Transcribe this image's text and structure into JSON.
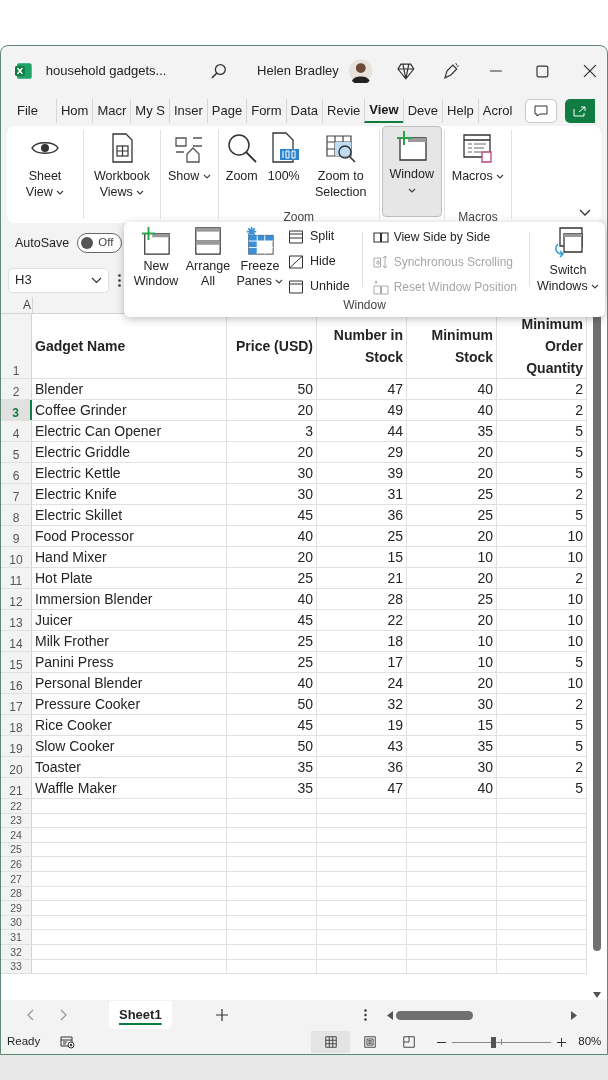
{
  "window": {
    "title": "household gadgets...",
    "user": "Helen Bradley"
  },
  "tabs": [
    {
      "label": "File",
      "selected": false
    },
    {
      "label": "Hom",
      "selected": false
    },
    {
      "label": "Macr",
      "selected": false
    },
    {
      "label": "My S",
      "selected": false
    },
    {
      "label": "Inser",
      "selected": false
    },
    {
      "label": "Page",
      "selected": false
    },
    {
      "label": "Form",
      "selected": false
    },
    {
      "label": "Data",
      "selected": false
    },
    {
      "label": "Revie",
      "selected": false
    },
    {
      "label": "View",
      "selected": true
    },
    {
      "label": "Deve",
      "selected": false
    },
    {
      "label": "Help",
      "selected": false
    },
    {
      "label": "Acrol",
      "selected": false
    }
  ],
  "ribbon": {
    "groups": [
      {
        "buttons": [
          {
            "kind": "eye",
            "label": "Sheet View",
            "dropdown": true,
            "selected": false
          }
        ]
      },
      {
        "buttons": [
          {
            "kind": "workbook",
            "label": "Workbook Views",
            "dropdown": true,
            "selected": false
          }
        ]
      },
      {
        "buttons": [
          {
            "kind": "show",
            "label": "Show",
            "dropdown": true,
            "selected": false
          }
        ]
      },
      {
        "label": "Zoom",
        "buttons": [
          {
            "kind": "zoom",
            "label": "Zoom",
            "dropdown": false,
            "selected": false
          },
          {
            "kind": "hundred",
            "label": "100%",
            "dropdown": false,
            "selected": false
          },
          {
            "kind": "zoomsel",
            "label": "Zoom to Selection",
            "dropdown": false,
            "selected": false
          }
        ]
      },
      {
        "buttons": [
          {
            "kind": "window",
            "label": "Window",
            "dropdown": true,
            "selected": true
          }
        ]
      },
      {
        "label": "Macros",
        "buttons": [
          {
            "kind": "macros",
            "label": "Macros",
            "dropdown": true,
            "selected": false
          }
        ]
      }
    ]
  },
  "autosave": {
    "label": "AutoSave",
    "on": false,
    "state_label": "Off"
  },
  "name_box": {
    "value": "H3"
  },
  "window_panel": {
    "label": "Window",
    "large_buttons": [
      {
        "kind": "newwin",
        "label": "New Window",
        "dropdown": false
      },
      {
        "kind": "arrange",
        "label": "Arrange All",
        "dropdown": false
      },
      {
        "kind": "freeze",
        "label": "Freeze Panes",
        "dropdown": true
      }
    ],
    "small_buttons": [
      {
        "kind": "split",
        "label": "Split"
      },
      {
        "kind": "hide",
        "label": "Hide"
      },
      {
        "kind": "unhide",
        "label": "Unhide"
      }
    ],
    "compare_buttons": [
      {
        "kind": "sidebyside",
        "label": "View Side by Side",
        "disabled": false
      },
      {
        "kind": "sync",
        "label": "Synchronous Scrolling",
        "disabled": true
      },
      {
        "kind": "reset",
        "label": "Reset Window Position",
        "disabled": true
      }
    ],
    "switch_button": {
      "kind": "switch",
      "label": "Switch Windows",
      "dropdown": true
    }
  },
  "sheet": {
    "column_headers": [
      "A"
    ],
    "columns": [
      "Gadget Name",
      "Price (USD)",
      "Number in Stock",
      "Minimum Stock",
      "Minimum Order Quantity"
    ],
    "rows": [
      [
        "Blender",
        "50",
        "47",
        "40",
        "2"
      ],
      [
        "Coffee Grinder",
        "20",
        "49",
        "40",
        "2"
      ],
      [
        "Electric Can Opener",
        "3",
        "44",
        "35",
        "5"
      ],
      [
        "Electric Griddle",
        "20",
        "29",
        "20",
        "5"
      ],
      [
        "Electric Kettle",
        "30",
        "39",
        "20",
        "5"
      ],
      [
        "Electric Knife",
        "30",
        "31",
        "25",
        "2"
      ],
      [
        "Electric Skillet",
        "45",
        "36",
        "25",
        "5"
      ],
      [
        "Food Processor",
        "40",
        "25",
        "20",
        "10"
      ],
      [
        "Hand Mixer",
        "20",
        "15",
        "10",
        "10"
      ],
      [
        "Hot Plate",
        "25",
        "21",
        "20",
        "2"
      ],
      [
        "Immersion Blender",
        "40",
        "28",
        "25",
        "10"
      ],
      [
        "Juicer",
        "45",
        "22",
        "20",
        "10"
      ],
      [
        "Milk Frother",
        "25",
        "18",
        "10",
        "10"
      ],
      [
        "Panini Press",
        "25",
        "17",
        "10",
        "5"
      ],
      [
        "Personal Blender",
        "40",
        "24",
        "20",
        "10"
      ],
      [
        "Pressure Cooker",
        "50",
        "32",
        "30",
        "2"
      ],
      [
        "Rice Cooker",
        "45",
        "19",
        "15",
        "5"
      ],
      [
        "Slow Cooker",
        "50",
        "43",
        "35",
        "5"
      ],
      [
        "Toaster",
        "35",
        "36",
        "30",
        "2"
      ],
      [
        "Waffle Maker",
        "35",
        "47",
        "40",
        "5"
      ]
    ],
    "row_headers": [
      {
        "label": "1",
        "selected": false
      },
      {
        "label": "2",
        "selected": false
      },
      {
        "label": "3",
        "selected": true
      },
      {
        "label": "4",
        "selected": false
      },
      {
        "label": "5",
        "selected": false
      },
      {
        "label": "6",
        "selected": false
      },
      {
        "label": "7",
        "selected": false
      },
      {
        "label": "8",
        "selected": false
      },
      {
        "label": "9",
        "selected": false
      },
      {
        "label": "10",
        "selected": false
      },
      {
        "label": "11",
        "selected": false
      },
      {
        "label": "12",
        "selected": false
      },
      {
        "label": "13",
        "selected": false
      },
      {
        "label": "14",
        "selected": false
      },
      {
        "label": "15",
        "selected": false
      },
      {
        "label": "16",
        "selected": false
      },
      {
        "label": "17",
        "selected": false
      },
      {
        "label": "18",
        "selected": false
      },
      {
        "label": "19",
        "selected": false
      },
      {
        "label": "20",
        "selected": false
      },
      {
        "label": "21",
        "selected": false
      },
      {
        "label": "22",
        "selected": false
      },
      {
        "label": "23",
        "selected": false
      },
      {
        "label": "24",
        "selected": false
      },
      {
        "label": "25",
        "selected": false
      },
      {
        "label": "26",
        "selected": false
      },
      {
        "label": "27",
        "selected": false
      },
      {
        "label": "28",
        "selected": false
      },
      {
        "label": "29",
        "selected": false
      },
      {
        "label": "30",
        "selected": false
      },
      {
        "label": "31",
        "selected": false
      },
      {
        "label": "32",
        "selected": false
      },
      {
        "label": "33",
        "selected": false
      }
    ]
  },
  "sheet_tabs": [
    {
      "label": "Sheet1",
      "selected": true
    }
  ],
  "status_bar": {
    "status": "Ready",
    "views": [
      {
        "kind": "normal",
        "selected": true
      },
      {
        "kind": "page_layout",
        "selected": false
      },
      {
        "kind": "page_break",
        "selected": false
      }
    ],
    "zoom": {
      "level": 0.41,
      "reading": "80%"
    }
  }
}
